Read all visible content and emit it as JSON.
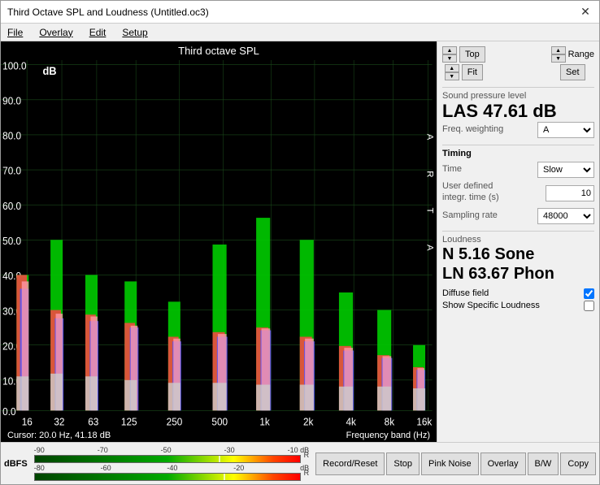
{
  "window": {
    "title": "Third Octave SPL and Loudness (Untitled.oc3)"
  },
  "menu": {
    "items": [
      "File",
      "Overlay",
      "Edit",
      "Setup"
    ]
  },
  "chart": {
    "title": "Third octave SPL",
    "arta_label": "A\nR\nT\nA",
    "y_axis": {
      "label": "dB",
      "values": [
        "100.0",
        "90.0",
        "80.0",
        "70.0",
        "60.0",
        "50.0",
        "40.0",
        "30.0",
        "20.0",
        "10.0",
        "0.0"
      ]
    },
    "x_axis": {
      "label": "Frequency band (Hz)",
      "values": [
        "16",
        "32",
        "63",
        "125",
        "250",
        "500",
        "1k",
        "2k",
        "4k",
        "8k",
        "16k"
      ]
    },
    "cursor_info": "Cursor:  20.0 Hz, 41.18 dB"
  },
  "top_controls": {
    "top_label": "Top",
    "range_label": "Range",
    "fit_label": "Fit",
    "set_label": "Set"
  },
  "spl": {
    "section_label": "Sound pressure level",
    "value": "LAS 47.61 dB",
    "freq_weighting_label": "Freq. weighting",
    "freq_weighting_value": "A"
  },
  "timing": {
    "section_label": "Timing",
    "time_label": "Time",
    "time_value": "Slow",
    "user_defined_label": "User defined integr. time (s)",
    "user_defined_value": "10",
    "sampling_rate_label": "Sampling rate",
    "sampling_rate_value": "48000"
  },
  "loudness": {
    "section_label": "Loudness",
    "n_value": "N 5.16 Sone",
    "ln_value": "LN 63.67 Phon",
    "diffuse_field_label": "Diffuse field",
    "diffuse_field_checked": true,
    "show_specific_label": "Show Specific Loudness",
    "show_specific_checked": false
  },
  "dbfs": {
    "label": "dBFS",
    "top_scale": [
      "-90",
      "-70",
      "-50",
      "-30",
      "-10 dB"
    ],
    "bottom_scale": [
      "-80",
      "-60",
      "-40",
      "-20",
      "dB"
    ]
  },
  "buttons": {
    "record_reset": "Record/Reset",
    "stop": "Stop",
    "pink_noise": "Pink Noise",
    "overlay": "Overlay",
    "bw": "B/W",
    "copy": "Copy"
  },
  "colors": {
    "background": "#000000",
    "grid": "#1a4a1a",
    "green_line": "#00cc00",
    "red_line": "#ff4444",
    "blue_line": "#4444ff",
    "white_line": "#dddddd",
    "pink_line": "#ffaaaa"
  }
}
